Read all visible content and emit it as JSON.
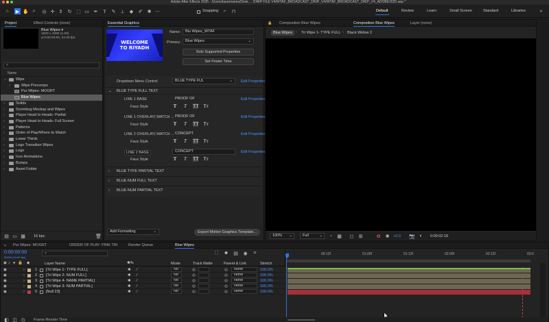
{
  "app": {
    "title": "Adobe After Effects 2025 - /Users/laurenanes/Desk ... /DRIP FILE V4/WTAF_BROADCAST_DRIP_V4/WTAF_BROADCAST_DRIP_V4_ADOBE2025.aep *"
  },
  "toolbar": {
    "snapping_label": "Snapping",
    "workspaces": [
      "Default",
      "Review",
      "Learn",
      "Small Screen",
      "Standard",
      "Libraries"
    ],
    "active_workspace": "Default"
  },
  "project": {
    "tabs": [
      "Project",
      "Effect Controls (none)"
    ],
    "selected_name": "Blue Wipes ▾",
    "selected_info": [
      "1920 x 1080 (1.00)",
      "Δ 0:00:03:00, 24.00 fps"
    ],
    "search_placeholder": "Q̲",
    "column_name": "Name",
    "items": [
      {
        "label": "Wipe",
        "level": 0,
        "expanded": true
      },
      {
        "label": "Wipe Precomps",
        "level": 1,
        "expanded": false
      },
      {
        "label": "Pur Wipes- MOGRT",
        "level": 1,
        "comp": true
      },
      {
        "label": "Blue Wipes",
        "level": 1,
        "comp": true,
        "selected": true
      },
      {
        "label": "Solids",
        "level": 0
      },
      {
        "label": "Scorebug Mockup and Wipes",
        "level": 0
      },
      {
        "label": "Player Head to Heads- Partial",
        "level": 0
      },
      {
        "label": "Player Head to Heads- Full Screen",
        "level": 0
      },
      {
        "label": "Patterns",
        "level": 0
      },
      {
        "label": "Order of Play/Where to Watch",
        "level": 0
      },
      {
        "label": "Lower Thirds",
        "level": 0
      },
      {
        "label": "Logo Transition Wipes",
        "level": 0
      },
      {
        "label": "Logo",
        "level": 0
      },
      {
        "label": "Icon Animations",
        "level": 0
      },
      {
        "label": "Bumps",
        "level": 0
      },
      {
        "label": "Asset Folder",
        "level": 0
      }
    ],
    "bpc": "16 bpc"
  },
  "essential_graphics": {
    "title": "Essential Graphics",
    "thumbnail_text": [
      "WELCOME",
      "TO RIYADH"
    ],
    "name_label": "Name:",
    "name_value": "Blu Wipes_WTAF",
    "primary_label": "Primary:",
    "primary_value": "Blue Wipes",
    "solo_button": "Solo Supported Properties",
    "poster_button": "Set Poster Time",
    "dropdown_control_label": "Dropdown Menu Control",
    "dropdown_control_value": "BLUE TYPE FUL",
    "edit_properties": "Edit Properties",
    "group_open": "BLUE TYPE FULL TEXT",
    "lines": [
      {
        "name": "LINE 1 BASE",
        "value": "PROOF OF",
        "faux": "Faux Style"
      },
      {
        "name": "LINE 1 OVERLAY( MATCH ...",
        "value": "PROOF OF",
        "faux": "Faux Style"
      },
      {
        "name": "LINE 2 OVERLAY( MATCH ...",
        "value": "CONCEPT",
        "faux": "Faux Style"
      },
      {
        "name": "LINE 2 BASE",
        "value": "CONCEPT",
        "faux": "Faux Style"
      }
    ],
    "faux_glyphs": [
      "T",
      "T",
      "TT",
      "Tᴛ"
    ],
    "collapsed_groups": [
      "BLUE TYPE PARTIAL TEXT",
      "BLUE NUM FULL TEXT",
      "BLUE NUM PARTIAL TEXT"
    ],
    "add_formatting": "Add Formatting",
    "export_button": "Export Motion Graphics Template..."
  },
  "composition": {
    "tabs": [
      "Composition Blue Wipes",
      "Composition Blue Wipes",
      "Layer (none)"
    ],
    "breadcrumbs": [
      "Blue Wipes",
      "Tri Wipe 1- TYPE FULL",
      "Black Widow 2"
    ],
    "zoom": "100%",
    "quality": "Full",
    "exposure": "+0.0",
    "timecode": "0:00:02:18"
  },
  "timeline": {
    "tabs": [
      "Pur Wipes- MOGRT",
      "ORDER OF PLAY- PINK TRI",
      "Render Queue",
      "Blue Wipes"
    ],
    "active_tab": "Blue Wipes",
    "timecode": "0:00:00:00",
    "timecode_sub": "00000 (24.00 fps)",
    "columns": {
      "layer_name": "Layer Name",
      "mode": "Mode",
      "track_matte": "Track Matte",
      "parent": "Parent & Link",
      "stretch": "Stretch"
    },
    "layers": [
      {
        "num": "1",
        "name": "[Tri Wipe 1- TYPE FULL]",
        "mode": "No",
        "parent": "None",
        "stretch": "100.0%",
        "color": "#c9b18a"
      },
      {
        "num": "2",
        "name": "[Tri Wipe 2- NUM FULL]",
        "mode": "No",
        "parent": "None",
        "stretch": "100.0%",
        "color": "#c9b18a"
      },
      {
        "num": "3",
        "name": "[Tri Wipe 4- NAME PARTIAL]",
        "mode": "No",
        "parent": "None",
        "stretch": "100.0%",
        "color": "#c9b18a"
      },
      {
        "num": "4",
        "name": "[Tri Wipe 3- NUM PARTIAL]",
        "mode": "No",
        "parent": "None",
        "stretch": "100.0%",
        "color": "#c9b18a"
      },
      {
        "num": "5",
        "name": "[Null 23]",
        "mode": "No",
        "parent": "None",
        "stretch": "100.0%",
        "color": "#c73a3a"
      }
    ],
    "ruler_labels": [
      "00:12f",
      "01:00f",
      "01:12f",
      "02:00f",
      "02:12f",
      "03:0"
    ],
    "footer": "Frame Render Time"
  }
}
